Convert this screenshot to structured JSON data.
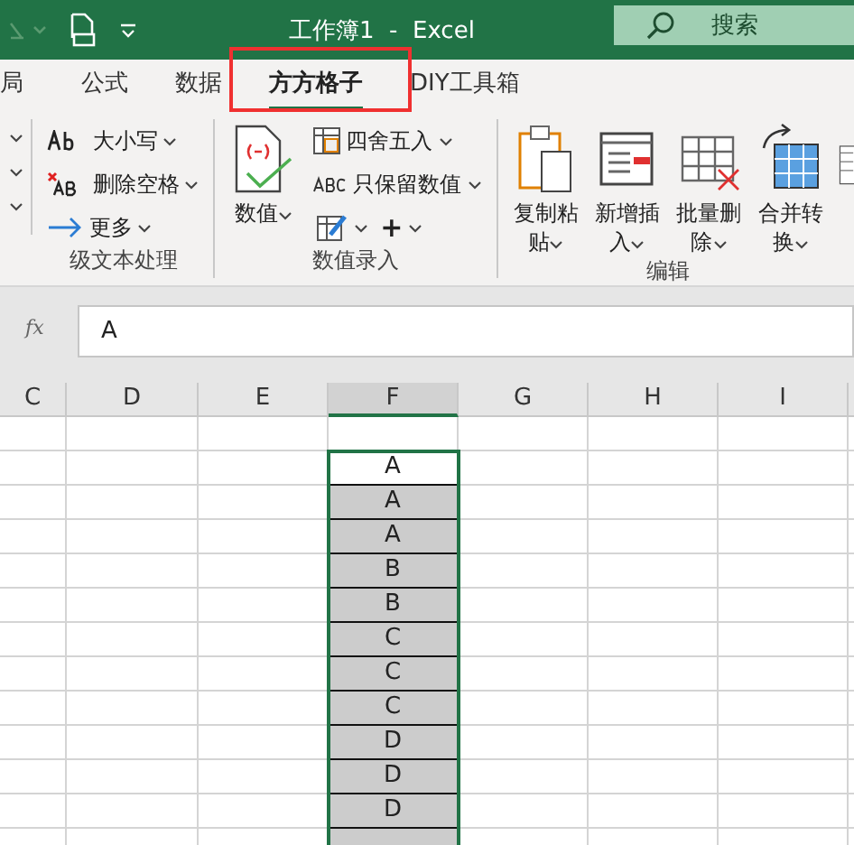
{
  "title_bar": {
    "title": "工作簿1  -  Excel",
    "search": {
      "placeholder": "搜索"
    }
  },
  "tabs": [
    {
      "label": "局",
      "selected": false
    },
    {
      "label": "公式",
      "selected": false
    },
    {
      "label": "数据",
      "selected": false
    },
    {
      "label": "方方格子",
      "selected": true
    },
    {
      "label": "DIY工具箱",
      "selected": false
    }
  ],
  "ribbon": {
    "groups": [
      {
        "label": "级文本处理",
        "items": [
          {
            "kind": "small",
            "label": "大小写"
          },
          {
            "kind": "small",
            "label": "删除空格"
          },
          {
            "kind": "small",
            "label": "更多"
          }
        ]
      },
      {
        "label": "数值录入",
        "items": [
          {
            "kind": "large",
            "label": "数值"
          },
          {
            "kind": "small",
            "label": "四舍五入"
          },
          {
            "kind": "small",
            "label": "只保留数值"
          },
          {
            "kind": "tools",
            "label": "+"
          }
        ]
      },
      {
        "label": "编辑",
        "items": [
          {
            "kind": "large",
            "label": "复制粘贴"
          },
          {
            "kind": "large",
            "label": "新增插入"
          },
          {
            "kind": "large",
            "label": "批量删除"
          },
          {
            "kind": "large",
            "label": "合并转换"
          }
        ]
      }
    ]
  },
  "formula_bar": {
    "fx": "fx",
    "value": "A"
  },
  "sheet": {
    "columns": [
      {
        "label": "C",
        "selected": false
      },
      {
        "label": "D",
        "selected": false
      },
      {
        "label": "E",
        "selected": false
      },
      {
        "label": "F",
        "selected": true
      },
      {
        "label": "G",
        "selected": false
      },
      {
        "label": "H",
        "selected": false
      },
      {
        "label": "I",
        "selected": false
      }
    ],
    "column_f": [
      {
        "active": false,
        "in_selection": false
      },
      {
        "value": "A",
        "active": true,
        "in_selection": true
      },
      {
        "value": "A",
        "active": false,
        "in_selection": true
      },
      {
        "value": "A",
        "active": false,
        "in_selection": true
      },
      {
        "value": "B",
        "active": false,
        "in_selection": true
      },
      {
        "value": "B",
        "active": false,
        "in_selection": true
      },
      {
        "value": "C",
        "active": false,
        "in_selection": true
      },
      {
        "value": "C",
        "active": false,
        "in_selection": true
      },
      {
        "value": "C",
        "active": false,
        "in_selection": true
      },
      {
        "value": "D",
        "active": false,
        "in_selection": true
      },
      {
        "value": "D",
        "active": false,
        "in_selection": true
      },
      {
        "value": "D",
        "active": false,
        "in_selection": true
      },
      {
        "active": false,
        "in_selection": true
      }
    ]
  }
}
